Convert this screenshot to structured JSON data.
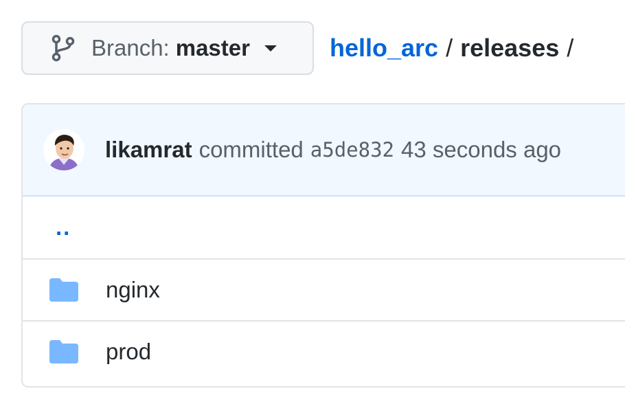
{
  "branch": {
    "prefix": "Branch:",
    "name": "master"
  },
  "breadcrumb": {
    "repo": "hello_arc",
    "separator": "/",
    "path": "releases",
    "trailing": "/"
  },
  "commit": {
    "author": "likamrat",
    "verb": "committed",
    "sha": "a5de832",
    "time": "43 seconds ago"
  },
  "parent_dir": "..",
  "entries": [
    {
      "name": "nginx",
      "icon": "folder-icon"
    },
    {
      "name": "prod",
      "icon": "folder-icon"
    }
  ],
  "colors": {
    "link": "#0366d6",
    "folder": "#79b8ff",
    "commit_bg": "#f1f8ff"
  }
}
